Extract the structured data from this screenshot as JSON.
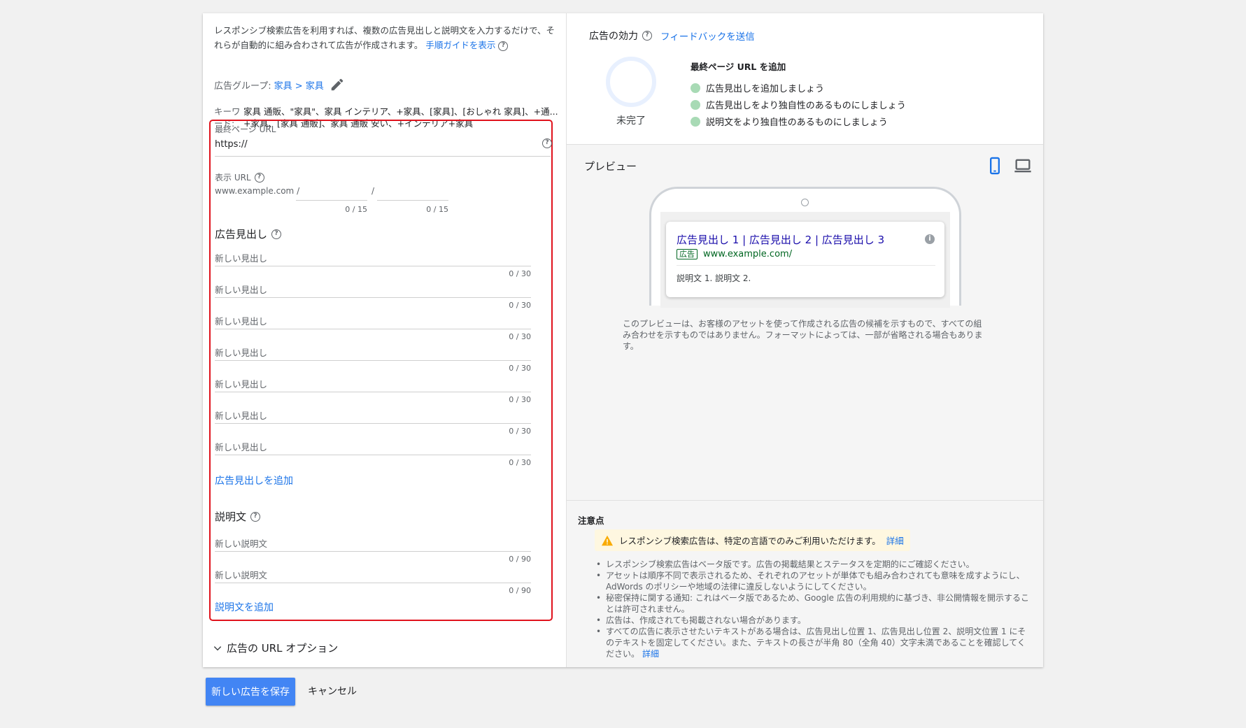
{
  "intro": {
    "text": "レスポンシブ検索広告を利用すれば、複数の広告見出しと説明文を入力するだけで、それらが自動的に組み合わされて広告が作成されます。",
    "guide_link": "手順ガイドを表示"
  },
  "ad_group": {
    "label": "広告グループ:",
    "path": "家具 > 家具"
  },
  "keywords": {
    "label": "キーワード:",
    "value": "家具 通販、\"家具\"、家具 インテリア、+家具、[家具]、[おしゃれ 家具]、+通...",
    "value_line2": "+家具、[家具 通販]、家具 通販 安い、+インテリア+家具"
  },
  "final_url": {
    "label": "最終ページ URL",
    "value": "https://"
  },
  "display_url": {
    "label": "表示 URL",
    "base": "www.example.com /",
    "separator": "/",
    "path1_counter": "0 / 15",
    "path2_counter": "0 / 15"
  },
  "headlines": {
    "title": "広告見出し",
    "items": [
      {
        "placeholder": "新しい見出し",
        "counter": "0 / 30"
      },
      {
        "placeholder": "新しい見出し",
        "counter": "0 / 30"
      },
      {
        "placeholder": "新しい見出し",
        "counter": "0 / 30"
      },
      {
        "placeholder": "新しい見出し",
        "counter": "0 / 30"
      },
      {
        "placeholder": "新しい見出し",
        "counter": "0 / 30"
      },
      {
        "placeholder": "新しい見出し",
        "counter": "0 / 30"
      },
      {
        "placeholder": "新しい見出し",
        "counter": "0 / 30"
      }
    ],
    "add_link": "広告見出しを追加"
  },
  "descriptions": {
    "title": "説明文",
    "items": [
      {
        "placeholder": "新しい説明文",
        "counter": "0 / 90"
      },
      {
        "placeholder": "新しい説明文",
        "counter": "0 / 90"
      }
    ],
    "add_link": "説明文を追加"
  },
  "url_options": {
    "label": "広告の URL オプション"
  },
  "effectiveness": {
    "title": "広告の効力",
    "feedback_link": "フィードバックを送信",
    "status": "未完了",
    "heading": "最終ページ URL を追加",
    "tips": [
      "広告見出しを追加しましょう",
      "広告見出しをより独自性のあるものにしましょう",
      "説明文をより独自性のあるものにしましょう"
    ],
    "tip_dot_color": "#a8dab5"
  },
  "preview": {
    "title": "プレビュー",
    "ad_headline": "広告見出し 1 | 広告見出し 2 | 広告見出し 3",
    "ad_badge": "広告",
    "ad_url": "www.example.com/",
    "ad_description": "説明文 1. 説明文 2.",
    "note": "このプレビューは、お客様のアセットを使って作成される広告の候補を示すもので、すべての組み合わせを示すものではありません。フォーマットによっては、一部が省略される場合もあります。",
    "mobile_icon_color": "#1a73e8"
  },
  "notes": {
    "title": "注意点",
    "warning": "レスポンシブ検索広告は、特定の言語でのみご利用いただけます。",
    "warning_link": "詳細",
    "items": [
      "レスポンシブ検索広告はベータ版です。広告の掲載結果とステータスを定期的にご確認ください。",
      "アセットは順序不同で表示されるため、それぞれのアセットが単体でも組み合わされても意味を成すようにし、AdWords のポリシーや地域の法律に違反しないようにしてください。",
      "秘密保持に関する通知: これはベータ版であるため、Google 広告の利用規約に基づき、非公開情報を開示することは許可されません。",
      "広告は、作成されても掲載されない場合があります。",
      "すべての広告に表示させたいテキストがある場合は、広告見出し位置 1、広告見出し位置 2、説明文位置 1 にそのテキストを固定してください。また、テキストの長さが半角 80（全角 40）文字未満であることを確認してください。"
    ],
    "last_item_link": "詳細"
  },
  "actions": {
    "save": "新しい広告を保存",
    "cancel": "キャンセル"
  },
  "colors": {
    "accent": "#1a73e8",
    "primary_button": "#4285f4",
    "highlight_border": "#e0121c",
    "warning_bg": "#fef7e0",
    "warning_icon": "#f9ab00"
  }
}
